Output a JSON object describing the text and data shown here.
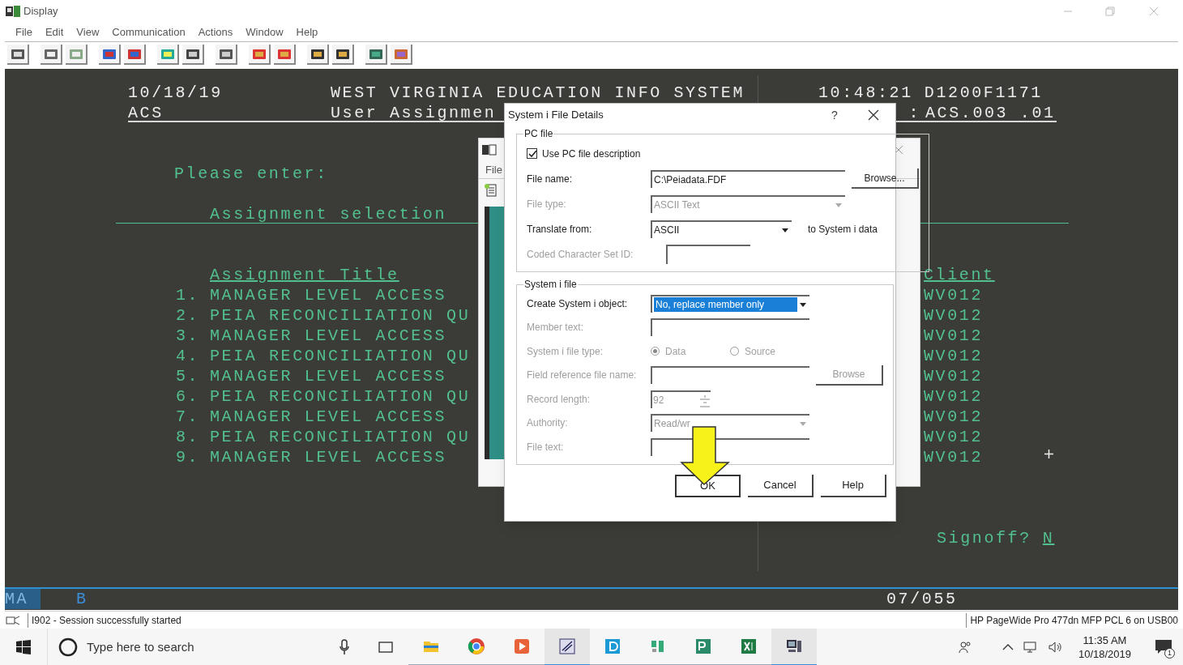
{
  "window": {
    "title": "Display"
  },
  "menu": [
    "File",
    "Edit",
    "View",
    "Communication",
    "Actions",
    "Window",
    "Help"
  ],
  "terminal": {
    "date": "10/18/19",
    "system_title": "WEST VIRGINIA EDUCATION INFO SYSTEM",
    "time": "10:48:21",
    "terminal_id": "D1200F1171",
    "app": "ACS",
    "screen_title": "User Assignmen",
    "screen_id_label": ":",
    "screen_id": "ACS.003 .01",
    "prompt": "Please enter:",
    "section": "Assignment selection",
    "columns": [
      "Assignment Title",
      "Client"
    ],
    "rows": [
      {
        "number": "1.",
        "title": "MANAGER LEVEL ACCESS",
        "client": "WV012"
      },
      {
        "number": "2.",
        "title": "PEIA RECONCILIATION QU",
        "client": "WV012"
      },
      {
        "number": "3.",
        "title": "MANAGER LEVEL ACCESS",
        "client": "WV012"
      },
      {
        "number": "4.",
        "title": "PEIA RECONCILIATION QU",
        "client": "WV012"
      },
      {
        "number": "5.",
        "title": "MANAGER LEVEL ACCESS",
        "client": "WV012"
      },
      {
        "number": "6.",
        "title": "PEIA RECONCILIATION QU",
        "client": "WV012"
      },
      {
        "number": "7.",
        "title": "MANAGER LEVEL ACCESS",
        "client": "WV012"
      },
      {
        "number": "8.",
        "title": "PEIA RECONCILIATION QU",
        "client": "WV012"
      },
      {
        "number": "9.",
        "title": "MANAGER LEVEL ACCESS",
        "client": "WV012"
      }
    ],
    "signoff_label": "Signoff?",
    "signoff_value": "N",
    "status_left": "MA",
    "status_mid": "B",
    "cursor_position": "07/055"
  },
  "background_window": {
    "menu_item": "File"
  },
  "dialog": {
    "title": "System i File Details",
    "help": "?",
    "groups": [
      {
        "legend": "PC file",
        "fields": [
          {
            "kind": "checkbox",
            "label": "Use PC file description",
            "checked": true
          },
          {
            "kind": "text",
            "label": "File name:",
            "value": "C:\\Peiadata.FDF",
            "disabled": false,
            "button": {
              "label": "Browse...",
              "disabled": false
            }
          },
          {
            "kind": "dropdown",
            "label": "File type:",
            "value": "ASCII Text",
            "disabled": true,
            "focused": false
          },
          {
            "kind": "dropdown",
            "label": "Translate from:",
            "value": "ASCII",
            "disabled": false,
            "focused": false,
            "suffix": "to System i data"
          },
          {
            "kind": "text",
            "label": "Coded Character Set ID:",
            "disabled": true
          }
        ]
      },
      {
        "legend": "System i file",
        "fields": [
          {
            "kind": "dropdown",
            "label": "Create System i object:",
            "value": "No, replace member only",
            "disabled": false,
            "focused": true
          },
          {
            "kind": "text",
            "label": "Member text:",
            "disabled": true
          },
          {
            "kind": "radio",
            "label": "System i file type:",
            "disabled": true,
            "options": [
              {
                "label": "Data",
                "selected": true
              },
              {
                "label": "Source",
                "selected": false
              }
            ]
          },
          {
            "kind": "text",
            "label": "Field reference file name:",
            "disabled": true,
            "button": {
              "label": "Browse",
              "disabled": true
            }
          },
          {
            "kind": "spin",
            "label": "Record length:",
            "value": "92",
            "disabled": true
          },
          {
            "kind": "dropdown",
            "label": "Authority:",
            "value": "Read/wr",
            "disabled": true,
            "focused": false
          },
          {
            "kind": "text",
            "label": "File text:",
            "disabled": true
          }
        ]
      }
    ],
    "buttons": [
      {
        "label": "OK",
        "default": true
      },
      {
        "label": "Cancel",
        "default": false
      },
      {
        "label": "Help",
        "default": false
      }
    ]
  },
  "status_bar": {
    "message": "I902 - Session successfully started",
    "printer": "HP PageWide Pro 477dn MFP PCL 6 on USB00"
  },
  "taskbar": {
    "search_placeholder": "Type here to search",
    "time": "11:35 AM",
    "date": "10/18/2019",
    "notification_count": "1"
  }
}
